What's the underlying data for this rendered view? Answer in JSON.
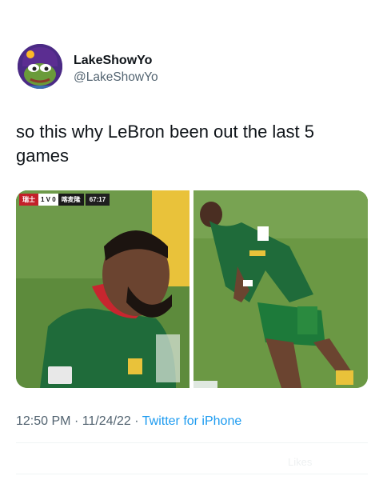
{
  "author": {
    "display_name": "LakeShowYo",
    "handle": "@LakeShowYo"
  },
  "tweet": {
    "text": "so this why LeBron been out the last 5 games"
  },
  "media": {
    "scorebug": {
      "team1": "瑞士",
      "score": "1 V 0",
      "team2": "喀麦隆",
      "time": "67:17"
    }
  },
  "meta": {
    "time": "12:50 PM",
    "separator": "·",
    "date": "11/24/22",
    "source": "Twitter for iPhone"
  },
  "footer": {
    "likes_label": "Likes"
  },
  "colors": {
    "text_primary": "#0f1419",
    "text_secondary": "#536471",
    "link": "#1d9bf0",
    "avatar_bg": "#4b2a85"
  }
}
